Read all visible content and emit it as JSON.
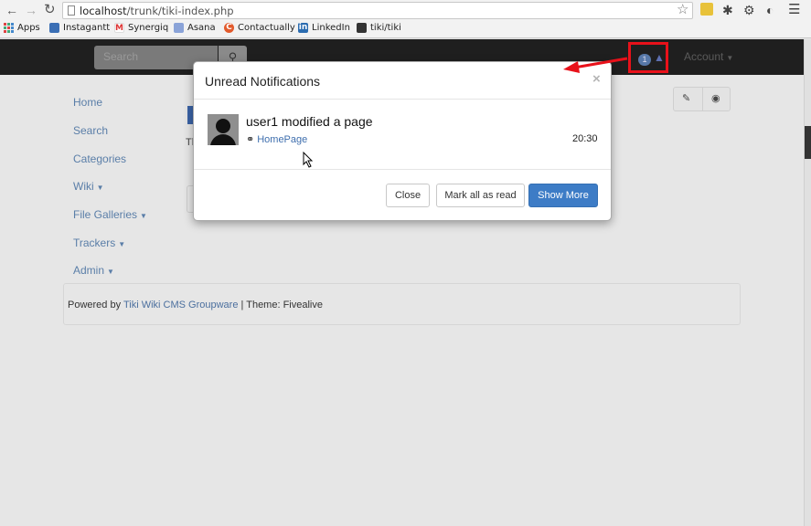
{
  "browser": {
    "url_host": "localhost",
    "url_path": "/trunk/tiki-index.php",
    "bookmarks": [
      {
        "label": "Apps"
      },
      {
        "label": "Instagantt"
      },
      {
        "label": "Synergiq"
      },
      {
        "label": "Asana"
      },
      {
        "label": "Contactually"
      },
      {
        "label": "LinkedIn"
      },
      {
        "label": "tiki/tiki"
      }
    ]
  },
  "navbar": {
    "search_placeholder": "Search",
    "notification_count": "1",
    "account_label": "Account"
  },
  "sidebar": {
    "items": [
      {
        "label": "Home"
      },
      {
        "label": "Search"
      },
      {
        "label": "Categories"
      },
      {
        "label": "Wiki"
      },
      {
        "label": "File Galleries"
      },
      {
        "label": "Trackers"
      },
      {
        "label": "Admin"
      }
    ]
  },
  "footer": {
    "prefix": "Powered by",
    "link": "Tiki Wiki CMS Groupware",
    "suffix": "| Theme: Fivealive"
  },
  "modal": {
    "title": "Unread Notifications",
    "close_symbol": "×",
    "notification": {
      "message": "user1 modified a page",
      "link": "HomePage",
      "time": "20:30"
    },
    "buttons": {
      "close": "Close",
      "mark_all": "Mark all as read",
      "show_more": "Show More"
    }
  },
  "page_fragment": "Th",
  "colors": {
    "highlight_box": "#e8111a",
    "primary_button": "#3d7cc6",
    "link": "#3f6fae"
  }
}
